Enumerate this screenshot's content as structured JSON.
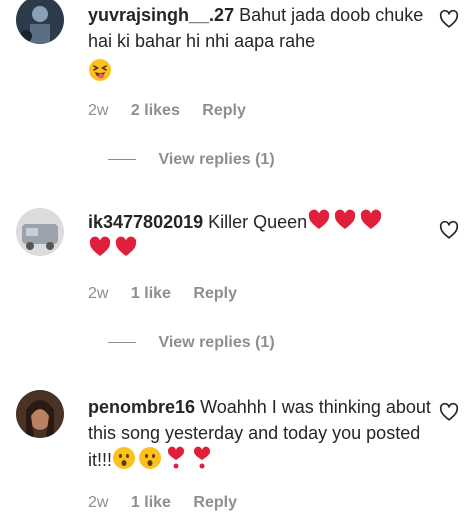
{
  "comments": [
    {
      "username": "yuvrajsingh__.27",
      "text": "Bahut jada doob chuke hai ki bahar hi nhi aapa rahe",
      "emojis": [
        "squinting-tongue-emoji"
      ],
      "time": "2w",
      "likes": "2 likes",
      "reply_label": "Reply",
      "view_replies": "View replies (1)"
    },
    {
      "username": "ik3477802019",
      "text": "Killer Queen",
      "emojis": [
        "red-heart-emoji",
        "red-heart-emoji",
        "red-heart-emoji",
        "red-heart-emoji",
        "red-heart-emoji"
      ],
      "time": "2w",
      "likes": "1 like",
      "reply_label": "Reply",
      "view_replies": "View replies (1)"
    },
    {
      "username": "penombre16",
      "text": "Woahhh I was thinking about this song yesterday and today you posted it!!!",
      "emojis": [
        "hushed-face-emoji",
        "hushed-face-emoji",
        "heart-exclamation-emoji",
        "heart-exclamation-emoji"
      ],
      "time": "2w",
      "likes": "1 like",
      "reply_label": "Reply"
    }
  ],
  "colors": {
    "text": "#262626",
    "secondary": "#8e8e8e",
    "heart": "#e0203a",
    "emoji_face": "#fcc21b"
  },
  "icons": {
    "like": "heart-outline-icon"
  }
}
